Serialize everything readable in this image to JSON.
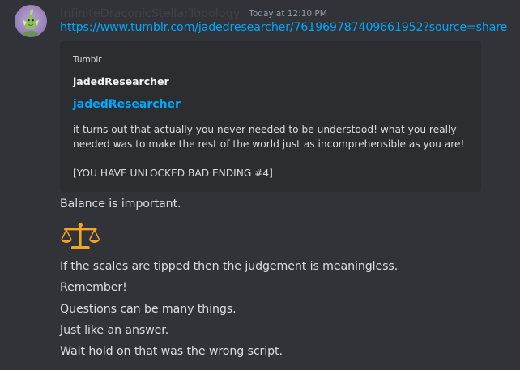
{
  "message": {
    "username": "InfiniteDraconicStellarTopology",
    "timestamp": "Today at 12:10 PM",
    "link": "https://www.tumblr.com/jadedresearcher/761969787409661952?source=share",
    "embed": {
      "provider": "Tumblr",
      "author": "jadedResearcher",
      "title": "jadedResearcher",
      "description_lines": [
        "it turns out that actually you never needed to be understood! what you really",
        "needed was to make the rest of the world just as incomprehensible as you are!",
        "[YOU HAVE UNLOCKED BAD ENDING #4]"
      ]
    },
    "lines": [
      "Balance is important.",
      "If the scales are tipped then the judgement is meaningless.",
      "Remember!",
      "Questions can be many things.",
      "Just like an answer.",
      "Wait hold on that was the wrong script."
    ],
    "emoji": "scales-emoji",
    "colors": {
      "background": "#313338",
      "embed_background": "#2b2d31",
      "link": "#00a8fc",
      "text": "#dbdee1",
      "timestamp": "#949ba4",
      "username": "#3f4147",
      "emoji_gold": "#f4a623"
    }
  }
}
